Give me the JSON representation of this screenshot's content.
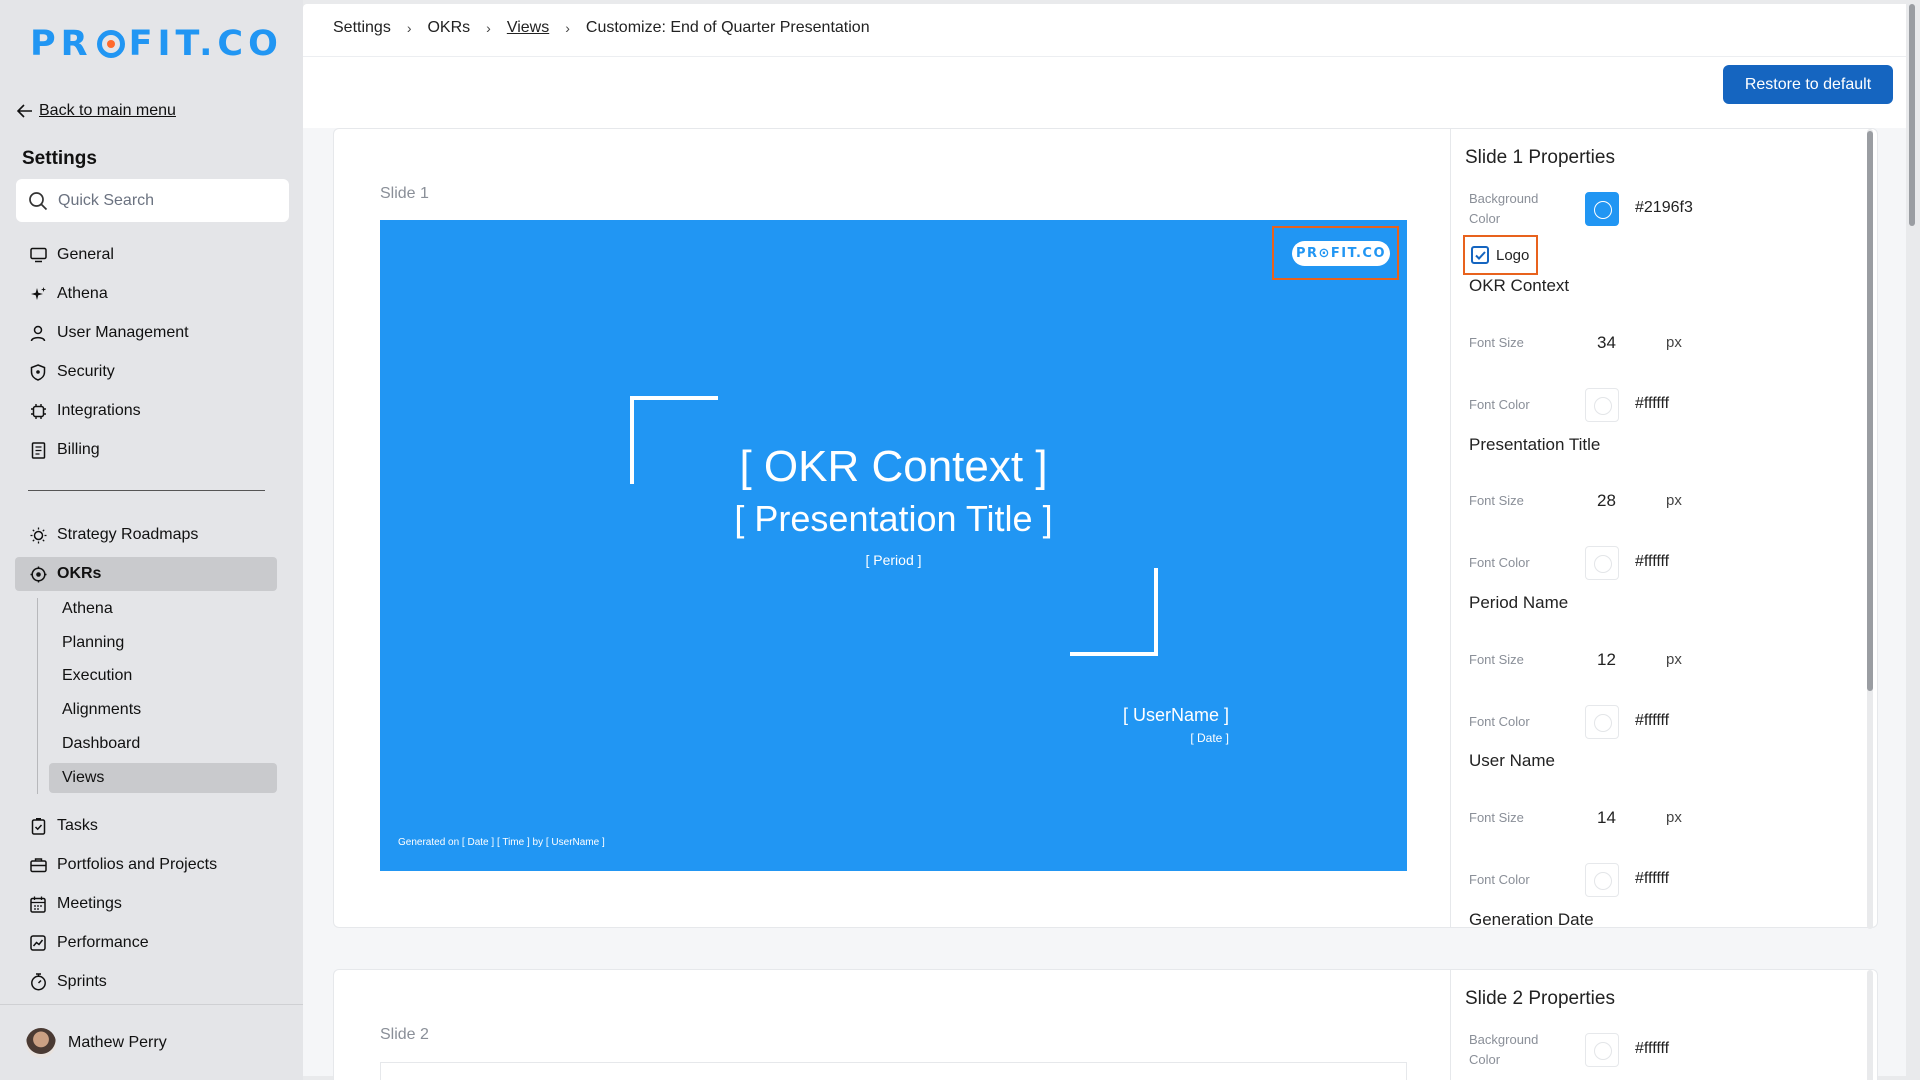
{
  "sidebar": {
    "logo": {
      "pre": "PR",
      "post": "FIT.CO"
    },
    "back_label": "Back to main menu",
    "title": "Settings",
    "search_placeholder": "Quick Search",
    "items": [
      {
        "label": "General",
        "icon": "monitor-icon"
      },
      {
        "label": "Athena",
        "icon": "sparkle-icon"
      },
      {
        "label": "User Management",
        "icon": "user-icon"
      },
      {
        "label": "Security",
        "icon": "shield-icon"
      },
      {
        "label": "Integrations",
        "icon": "chip-icon"
      },
      {
        "label": "Billing",
        "icon": "receipt-icon"
      }
    ],
    "items2": [
      {
        "label": "Strategy Roadmaps",
        "icon": "bulb-icon"
      },
      {
        "label": "OKRs",
        "icon": "target-icon"
      }
    ],
    "okr_sub": [
      "Athena",
      "Planning",
      "Execution",
      "Alignments",
      "Dashboard",
      "Views"
    ],
    "items3": [
      {
        "label": "Tasks",
        "icon": "clipboard-check-icon"
      },
      {
        "label": "Portfolios and Projects",
        "icon": "briefcase-icon"
      },
      {
        "label": "Meetings",
        "icon": "calendar-icon"
      },
      {
        "label": "Performance",
        "icon": "chart-icon"
      },
      {
        "label": "Sprints",
        "icon": "stopwatch-icon"
      }
    ],
    "user_name": "Mathew Perry"
  },
  "breadcrumb": [
    "Settings",
    "OKRs",
    "Views",
    "Customize: End of Quarter Presentation"
  ],
  "restore_label": "Restore to default",
  "slide1": {
    "label": "Slide 1",
    "background": "#2196f3",
    "logo_text": "PR⊙FIT.CO",
    "context": "[ OKR Context ]",
    "title": "[ Presentation Title ]",
    "period": "[ Period ]",
    "username": "[ UserName ]",
    "date": "[ Date ]",
    "generated": "Generated on [ Date ] [ Time ] by [ UserName ]"
  },
  "props1": {
    "heading": "Slide 1 Properties",
    "bg_label": "Background Color",
    "bg_value": "#2196f3",
    "logo_label": "Logo",
    "logo_checked": true,
    "font_size_label": "Font Size",
    "font_color_label": "Font Color",
    "unit": "px",
    "sections": [
      {
        "name": "OKR Context",
        "size": "34",
        "color": "#ffffff"
      },
      {
        "name": "Presentation Title",
        "size": "28",
        "color": "#ffffff"
      },
      {
        "name": "Period Name",
        "size": "12",
        "color": "#ffffff"
      },
      {
        "name": "User Name",
        "size": "14",
        "color": "#ffffff"
      }
    ],
    "next_section": "Generation Date"
  },
  "slide2": {
    "label": "Slide 2"
  },
  "props2": {
    "heading": "Slide 2 Properties",
    "bg_label": "Background Color",
    "bg_value": "#ffffff"
  }
}
